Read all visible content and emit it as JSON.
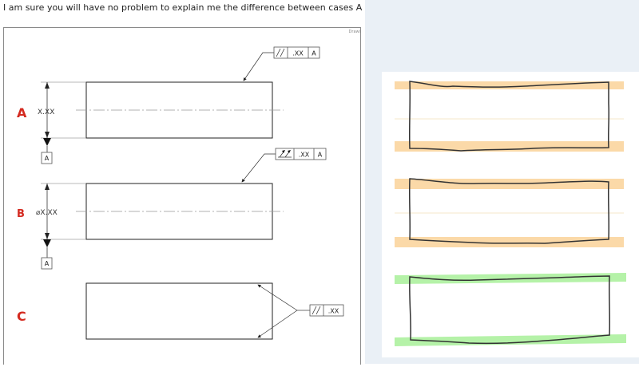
{
  "question": "I am sure you will have no problem to explain me the difference between cases A and B:",
  "frame_tag": "Drawi",
  "case_a": {
    "letter": "A",
    "dimension": "X.XX",
    "fcf_value": ".XX",
    "fcf_datum": "A",
    "datum_label": "A"
  },
  "case_b": {
    "letter": "B",
    "dimension": "⌀X.XX",
    "fcf_value": ".XX",
    "fcf_datum": "A",
    "datum_label": "A"
  },
  "case_c": {
    "letter": "C",
    "fcf_value": ".XX"
  },
  "colors": {
    "case_letter": "#d42a20",
    "zone_orange": "#fbd9a8",
    "zone_green": "#b5f2a8"
  }
}
